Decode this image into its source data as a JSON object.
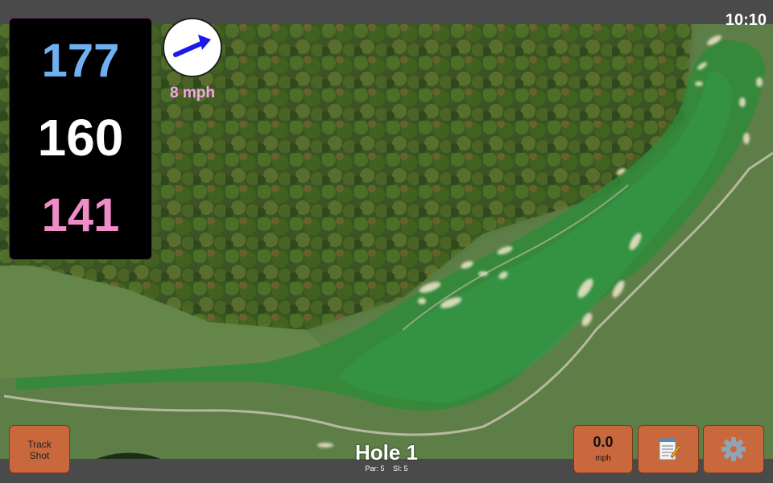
{
  "status_bar": {
    "time": "10:10"
  },
  "distances": {
    "back": "177",
    "middle": "160",
    "front": "141"
  },
  "wind": {
    "speed": "8 mph",
    "direction_icon": "arrow-icon"
  },
  "buttons": {
    "track_shot": "Track\nShot",
    "speed_value": "0.0",
    "speed_unit": "mph",
    "notes_icon": "notepad-icon",
    "settings_icon": "gear-icon"
  },
  "hole": {
    "title": "Hole 1",
    "par": "Par: 5",
    "si": "SI: 5"
  },
  "colors": {
    "back": "#6fb0f0",
    "middle": "#ffffff",
    "front": "#f08cc8",
    "wind_text": "#f4a8e8",
    "arrow": "#1a1ae8",
    "button": "#c9683c"
  }
}
